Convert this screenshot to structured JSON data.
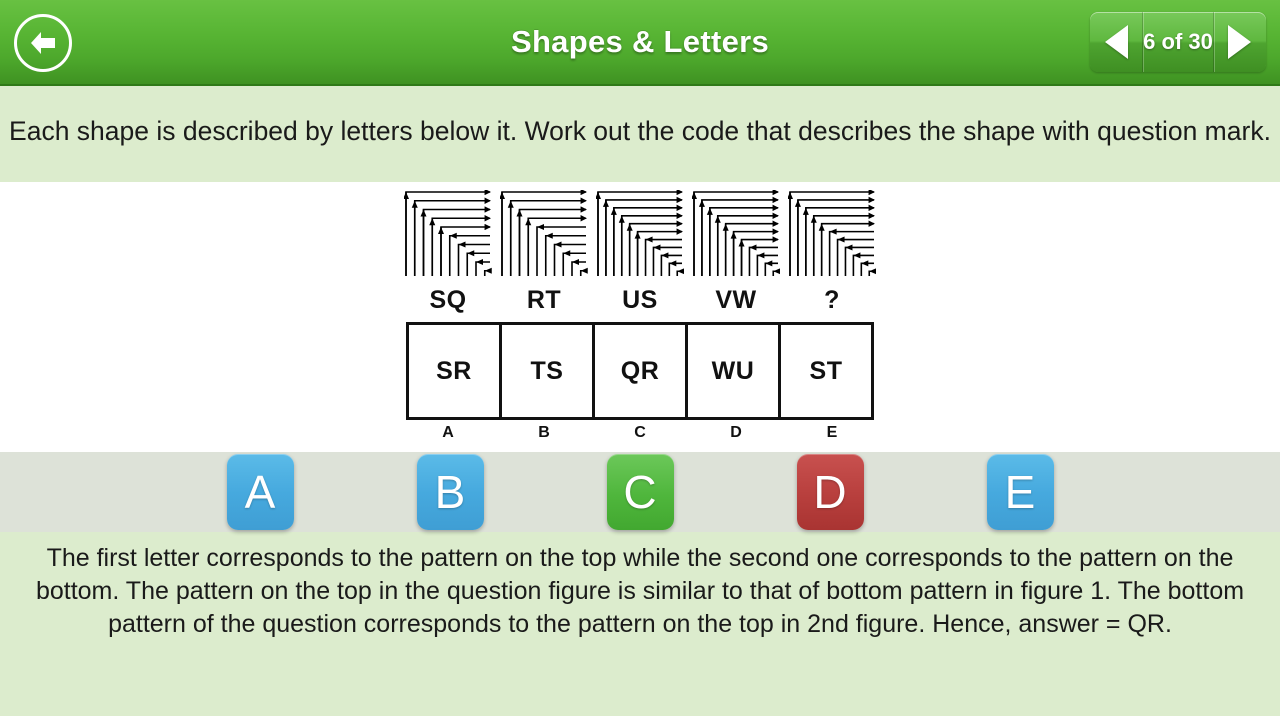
{
  "header": {
    "title": "Shapes & Letters",
    "back_icon": "back-arrow-icon",
    "pager": {
      "prev_icon": "triangle-left-icon",
      "next_icon": "triangle-right-icon",
      "count_label": "6 of 30",
      "current": 6,
      "total": 30
    },
    "colors": {
      "bg_top": "#68c142",
      "bg_bottom": "#3f9222",
      "title": "#ffffff"
    }
  },
  "question": {
    "text": "Each shape is described by letters below it. Work out the code that describes the shape with question mark.",
    "band_color": "#dceccd"
  },
  "figure": {
    "items": [
      {
        "label": "SQ",
        "icon": "nested-corner-arrows-icon",
        "verticals": 5,
        "horizontals": 5
      },
      {
        "label": "RT",
        "icon": "nested-corner-arrows-icon",
        "verticals": 4,
        "horizontals": 6
      },
      {
        "label": "US",
        "icon": "nested-corner-arrows-icon",
        "verticals": 6,
        "horizontals": 5
      },
      {
        "label": "VW",
        "icon": "nested-corner-arrows-icon",
        "verticals": 7,
        "horizontals": 4
      },
      {
        "label": "?",
        "icon": "nested-corner-arrows-icon",
        "verticals": 5,
        "horizontals": 6
      }
    ]
  },
  "options": {
    "cells": [
      "SR",
      "TS",
      "QR",
      "WU",
      "ST"
    ],
    "letters": [
      "A",
      "B",
      "C",
      "D",
      "E"
    ]
  },
  "answers": {
    "buttons": [
      {
        "label": "A",
        "state": "default",
        "color": "#46a9de"
      },
      {
        "label": "B",
        "state": "default",
        "color": "#46a9de"
      },
      {
        "label": "C",
        "state": "correct",
        "color": "#4fb63c"
      },
      {
        "label": "D",
        "state": "wrong",
        "color": "#b83f3d"
      },
      {
        "label": "E",
        "state": "default",
        "color": "#46a9de"
      }
    ],
    "strip_color": "#dde2d8"
  },
  "explanation": {
    "text": "The first letter corresponds to the pattern on the top while the second one corresponds to the pattern on the bottom. The pattern on the top in the question figure is similar to that of bottom pattern in figure 1. The bottom pattern of the question corresponds to the pattern on the top in 2nd figure. Hence, answer = QR."
  }
}
